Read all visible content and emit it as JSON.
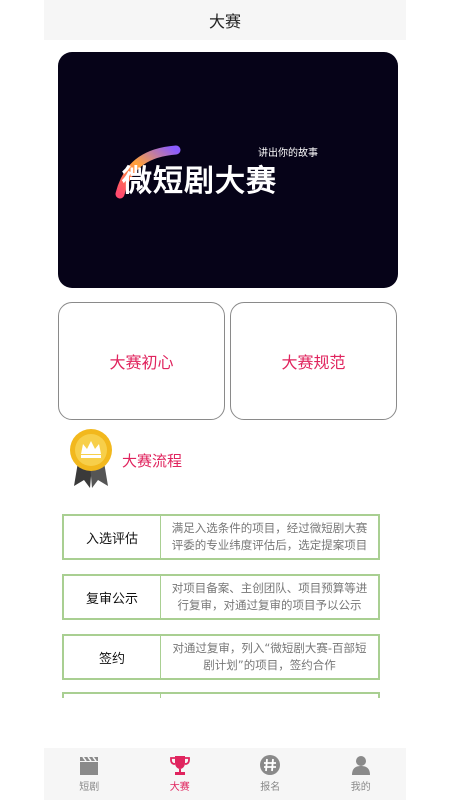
{
  "header": {
    "title": "大赛"
  },
  "banner": {
    "subtitle": "讲出你的故事",
    "title": "微短剧大赛"
  },
  "cards": [
    {
      "label": "大赛初心"
    },
    {
      "label": "大赛规范"
    }
  ],
  "process": {
    "label": "大赛流程"
  },
  "steps": [
    {
      "name": "入选评估",
      "desc": "满足入选条件的项目，经过微短剧大赛评委的专业纬度评估后，选定提案项目"
    },
    {
      "name": "复审公示",
      "desc": "对项目备案、主创团队、项目预算等进行复审，对通过复审的项目予以公示"
    },
    {
      "name": "签约",
      "desc": "对通过复审，列入“微短剧大赛-百部短剧计划”的项目，签约合作"
    }
  ],
  "tabbar": {
    "items": [
      {
        "label": "短剧",
        "icon": "clapperboard-icon"
      },
      {
        "label": "大赛",
        "icon": "trophy-icon"
      },
      {
        "label": "报名",
        "icon": "hashtag-icon"
      },
      {
        "label": "我的",
        "icon": "user-icon"
      }
    ],
    "active_color": "#e0245e",
    "inactive_color": "#8a8a8a"
  },
  "colors": {
    "accent": "#e0245e",
    "step_border": "#a9cf92",
    "banner_bg": "#060318"
  }
}
